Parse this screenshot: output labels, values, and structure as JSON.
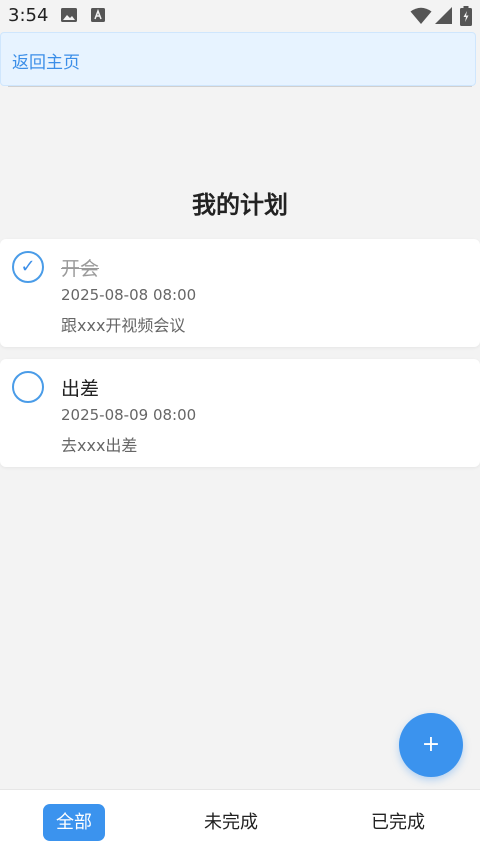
{
  "status_bar": {
    "time": "3:54",
    "icons": [
      "image-icon",
      "a-icon",
      "wifi-icon",
      "signal-icon",
      "battery-icon"
    ]
  },
  "header": {
    "back_label": "返回主页"
  },
  "page": {
    "title": "我的计划"
  },
  "plans": [
    {
      "title": "开会",
      "datetime": "2025-08-08 08:00",
      "description": "跟xxx开视频会议",
      "completed": true,
      "check_mark": "✓"
    },
    {
      "title": "出差",
      "datetime": "2025-08-09 08:00",
      "description": "去xxx出差",
      "completed": false,
      "check_mark": ""
    }
  ],
  "fab": {
    "label": "+"
  },
  "tabs": [
    {
      "label": "全部",
      "active": true
    },
    {
      "label": "未完成",
      "active": false
    },
    {
      "label": "已完成",
      "active": false
    }
  ],
  "colors": {
    "accent": "#3b93ee",
    "background": "#f3f3f3",
    "header_bg": "#e7f3ff"
  }
}
